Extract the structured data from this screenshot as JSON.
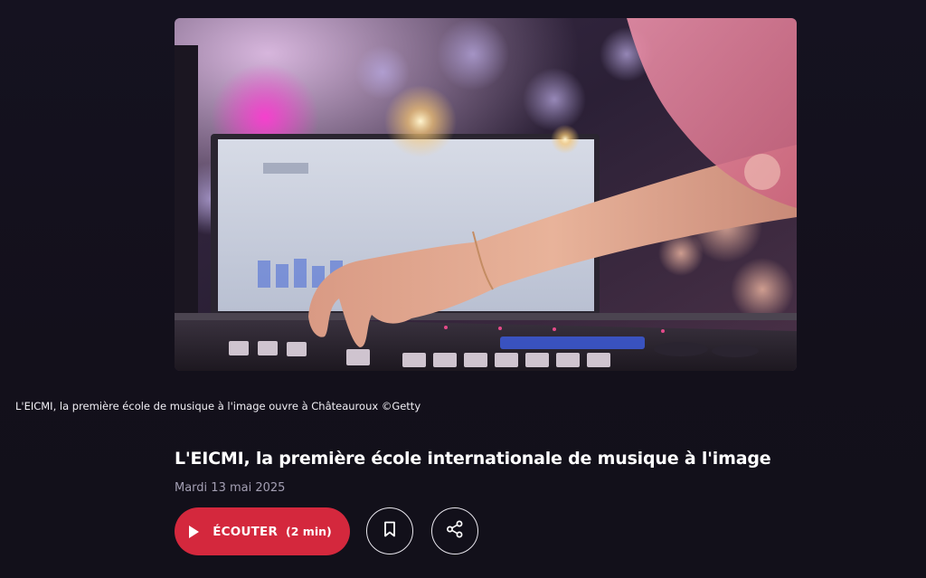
{
  "hero": {
    "image_alt": "Mains sur une table de mixage"
  },
  "caption": "L'EICMI, la première école de musique à l'image ouvre à Châteauroux ©Getty",
  "article": {
    "title": "L'EICMI, la première école internationale de musique à l'image",
    "date": "Mardi 13 mai 2025"
  },
  "actions": {
    "listen_label": "ÉCOUTER",
    "listen_duration": "(2 min)",
    "bookmark_icon": "bookmark-icon",
    "share_icon": "share-icon"
  },
  "colors": {
    "background": "#14111c",
    "accent": "#d4283d",
    "date_text": "#a39fb3"
  }
}
